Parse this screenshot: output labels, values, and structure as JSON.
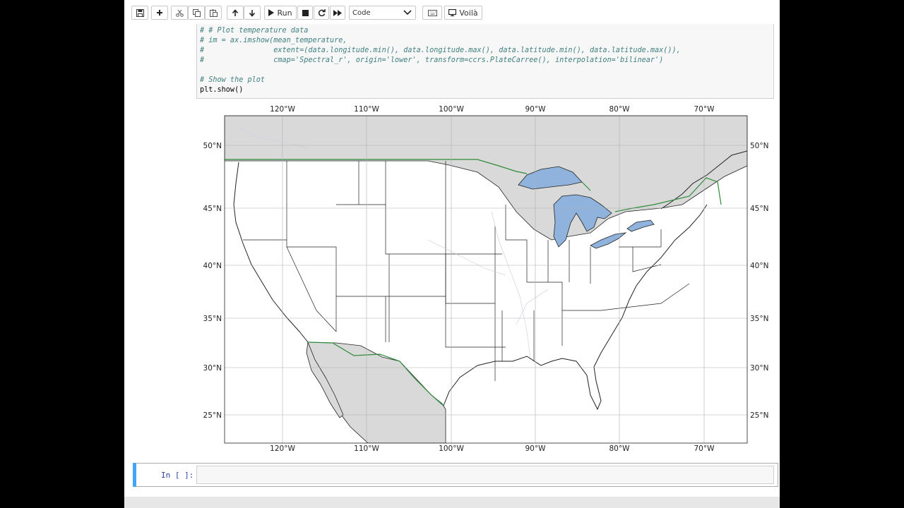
{
  "toolbar": {
    "run_label": "Run",
    "cell_type": "Code",
    "voila_label": "Voilà"
  },
  "code": {
    "lines": [
      "# # Plot temperature data",
      "# im = ax.imshow(mean_temperature,",
      "#                extent=(data.longitude.min(), data.longitude.max(), data.latitude.min(), data.latitude.max()),",
      "#                cmap='Spectral_r', origin='lower', transform=ccrs.PlateCarree(), interpolation='bilinear')",
      "",
      "# Show the plot",
      "plt.show()"
    ]
  },
  "map": {
    "lon_ticks": [
      "120°W",
      "110°W",
      "100°W",
      "90°W",
      "80°W",
      "70°W"
    ],
    "lat_ticks": [
      "50°N",
      "45°N",
      "40°N",
      "35°N",
      "30°N",
      "25°N"
    ],
    "colors": {
      "land_foreign": "#d9d9d9",
      "land_us": "#ffffff",
      "water": "#8fb3dd",
      "border": "#2e8b3a",
      "grid": "#b0b0b0"
    }
  },
  "next_cell": {
    "prompt": "In [ ]:"
  }
}
